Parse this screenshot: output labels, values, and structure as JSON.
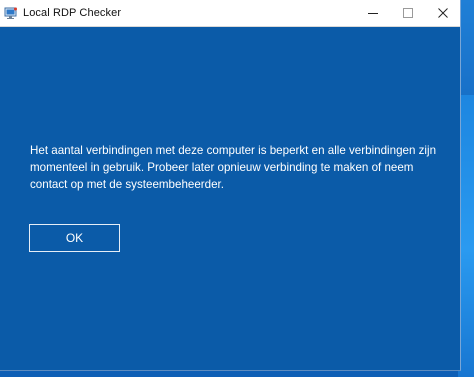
{
  "window": {
    "title": "Local RDP Checker",
    "app_icon": "remote-desktop-icon",
    "caption_buttons": [
      "minimize-icon",
      "maximize-icon",
      "close-icon"
    ]
  },
  "dialog": {
    "message": "Het aantal verbindingen met deze computer is beperkt en alle verbindingen zijn momenteel in gebruik. Probeer later opnieuw verbinding te maken of neem contact op met de systeembeheerder.",
    "ok_label": "OK"
  },
  "colors": {
    "dialog_background": "#0b5ba8",
    "titlebar_background": "#ffffff",
    "text": "#ffffff"
  }
}
